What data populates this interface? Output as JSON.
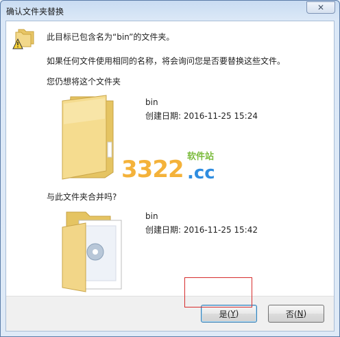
{
  "window": {
    "title": "确认文件夹替换",
    "close_glyph": "✕"
  },
  "dialog": {
    "line1": "此目标已包含名为“bin”的文件夹。",
    "line2": "如果任何文件使用相同的名称，将会询问您是否要替换这些文件。",
    "line3": "您仍想将这个文件夹",
    "target_folder": {
      "name": "bin",
      "created": "创建日期: 2016-11-25 15:24"
    },
    "merge_question": "与此文件夹合并吗?",
    "source_folder": {
      "name": "bin",
      "created": "创建日期: 2016-11-25 15:42"
    }
  },
  "watermark": {
    "number": "3322",
    "domain": ".cc",
    "site_label": "软件站"
  },
  "buttons": {
    "yes": {
      "label": "是(",
      "key": "Y",
      "end": ")"
    },
    "no": {
      "label": "否(",
      "key": "N",
      "end": ")"
    }
  },
  "colors": {
    "highlight": "#d62b2b",
    "folder": "#f0d58a",
    "accent": "#3c7fb1"
  }
}
